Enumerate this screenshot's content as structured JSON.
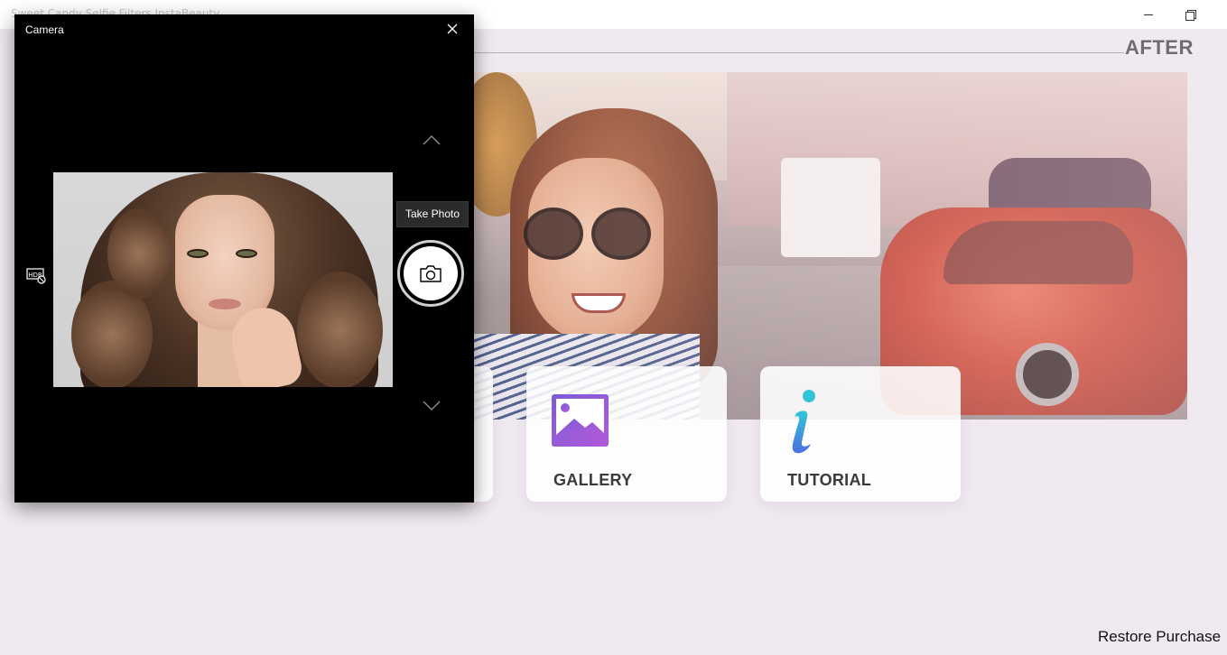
{
  "app": {
    "title": "Sweet Candy Selfie Filters InstaBeauty",
    "after_label": "AFTER",
    "restore_label": "Restore Purchase"
  },
  "cards": [
    {
      "label": "GALLERY",
      "icon": "gallery-icon"
    },
    {
      "label": "TUTORIAL",
      "icon": "info-icon"
    }
  ],
  "camera": {
    "title": "Camera",
    "tooltip": "Take Photo",
    "icons": [
      "close-icon",
      "chevron-up-icon",
      "chevron-down-icon",
      "hdr-off-icon",
      "camera-icon"
    ]
  },
  "colors": {
    "app_background": "#f0e9f0",
    "camera_background": "#000000",
    "gallery_icon_gradient": [
      "#7b5cd6",
      "#b25ad9"
    ],
    "tutorial_icon_gradient": [
      "#31c6d6",
      "#4b6fe0"
    ]
  }
}
